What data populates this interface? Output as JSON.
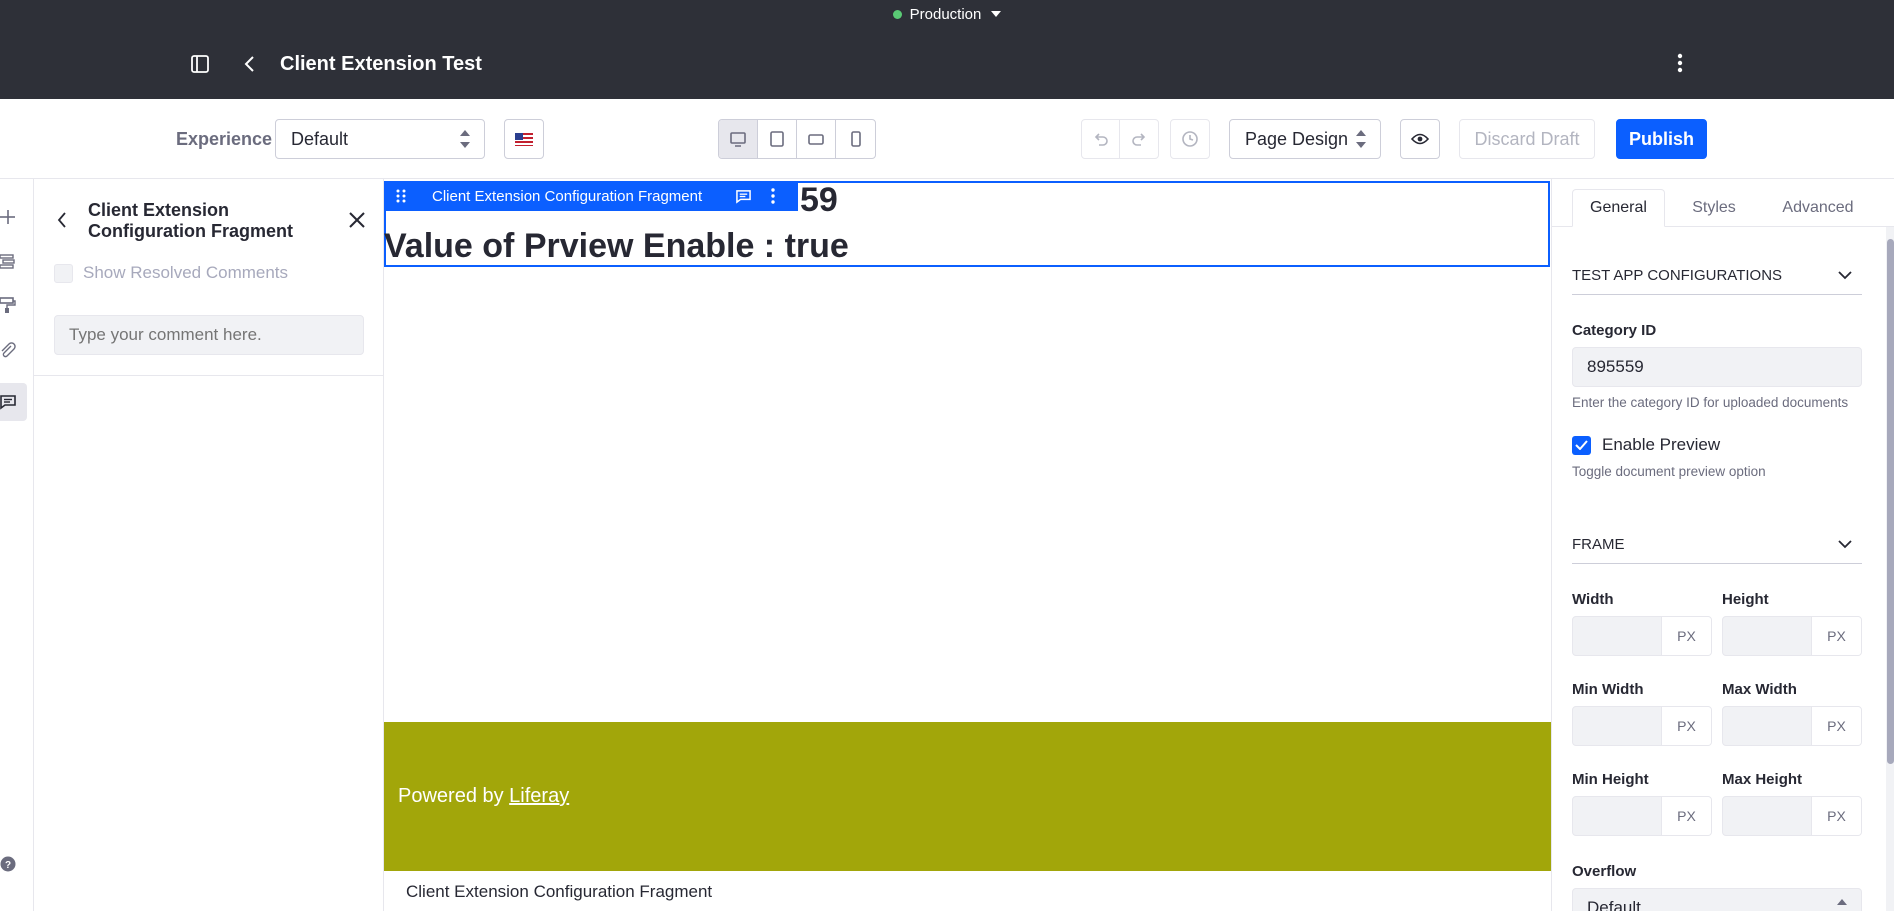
{
  "env": {
    "name": "Production"
  },
  "header": {
    "title": "Client Extension Test"
  },
  "toolbar": {
    "experience_label": "Experience",
    "experience_value": "Default",
    "mode_value": "Page Design",
    "discard_label": "Discard Draft",
    "publish_label": "Publish"
  },
  "sidebar": {
    "title_line1": "Client Extension",
    "title_line2": "Configuration Fragment",
    "show_resolved_label": "Show Resolved Comments",
    "comment_placeholder": "Type your comment here."
  },
  "canvas": {
    "fragment_toolbar_label": "Client Extension Configuration Fragment",
    "partial_heading": "59",
    "preview_line": "Value of Prview Enable : true",
    "footer_prefix": "Powered by ",
    "footer_link": "Liferay",
    "bottom_label": "Client Extension Configuration Fragment"
  },
  "right": {
    "tabs": [
      "General",
      "Styles",
      "Advanced"
    ],
    "section1": "TEST APP CONFIGURATIONS",
    "category_label": "Category ID",
    "category_value": "895559",
    "category_help": "Enter the category ID for uploaded documents",
    "enable_preview_label": "Enable Preview",
    "enable_preview_checked": true,
    "enable_preview_help": "Toggle document preview option",
    "section2": "FRAME",
    "width_label": "Width",
    "height_label": "Height",
    "min_width_label": "Min Width",
    "max_width_label": "Max Width",
    "min_height_label": "Min Height",
    "max_height_label": "Max Height",
    "unit": "PX",
    "overflow_label": "Overflow",
    "overflow_value": "Default"
  },
  "colors": {
    "dark": "#2e3038",
    "primary": "#0b5fff",
    "footer": "#a2a60a",
    "env_dot": "#5aca75"
  }
}
